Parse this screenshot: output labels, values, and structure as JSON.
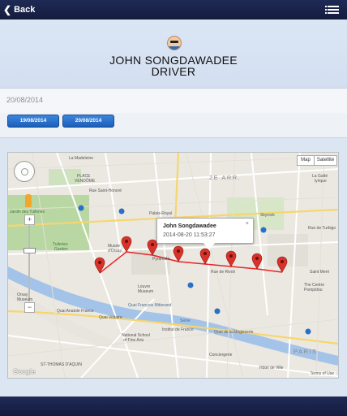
{
  "topbar": {
    "back_label": "Back",
    "menu_icon": "list-menu-icon"
  },
  "driver": {
    "name": "JOHN SONGDAWADEE",
    "role": "DRIVER"
  },
  "current_date": "20/08/2014",
  "date_buttons": [
    {
      "label": "19/08/2014"
    },
    {
      "label": "20/08/2014"
    }
  ],
  "map": {
    "type_controls": {
      "map": "Map",
      "satellite": "Satellite"
    },
    "infowindow": {
      "title": "John Songdawadee",
      "time": "2014-08-20 11:53:27",
      "close": "×"
    },
    "labels": {
      "madeleine": "La Madeleine",
      "place_vendome_1": "PLACE",
      "place_vendome_2": "VENDÔME",
      "jardin_tuileries": "Jardin des Tuileries",
      "tuileries_garden_1": "Tuileries",
      "tuileries_garden_2": "Garden",
      "musee_orsay_1": "Musée",
      "musee_orsay_2": "d'Orsay",
      "orsay_museum_1": "Orsay",
      "orsay_museum_2": "Museum",
      "quai_mitterand": "Quai François Mitterand",
      "quai_anatole": "Quai Anatole France",
      "quai_voltaire": "Quai Voltaire",
      "quai_megisserie": "Quai de la Mégisserie",
      "louvre_1": "Louvre",
      "louvre_2": "Museum",
      "pyramide": "Pyramide",
      "palais_royal": "Palais-Royal",
      "arrondissement_2": "2E ARR.",
      "rue_de_rivoli": "Rue de Rivoli",
      "rue_saint_honore": "Rue Saint-Honoré",
      "skyrock": "Skyrock",
      "gaite_lyrique_1": "La Gaîté",
      "gaite_lyrique_2": "lyrique",
      "centre_pompidou_1": "The Centre",
      "centre_pompidou_2": "Pompidou",
      "saint_merri": "Saint Merri",
      "rue_turbigo": "Rue de Turbigo",
      "paris": "PARIS",
      "fine_arts_1": "National School",
      "fine_arts_2": "of Fine Arts",
      "conciergerie": "Conciergerie",
      "hotel_de_ville": "Hôtel de Ville",
      "ecole": "Institut de France",
      "seine": "Seine",
      "saint_thomas": "ST-THOMAS D'AQUIN"
    },
    "google_logo": "Google",
    "terms": "Terms of Use"
  },
  "route": {
    "line_color": "#e8242a",
    "marker_color": "#d8332a"
  }
}
